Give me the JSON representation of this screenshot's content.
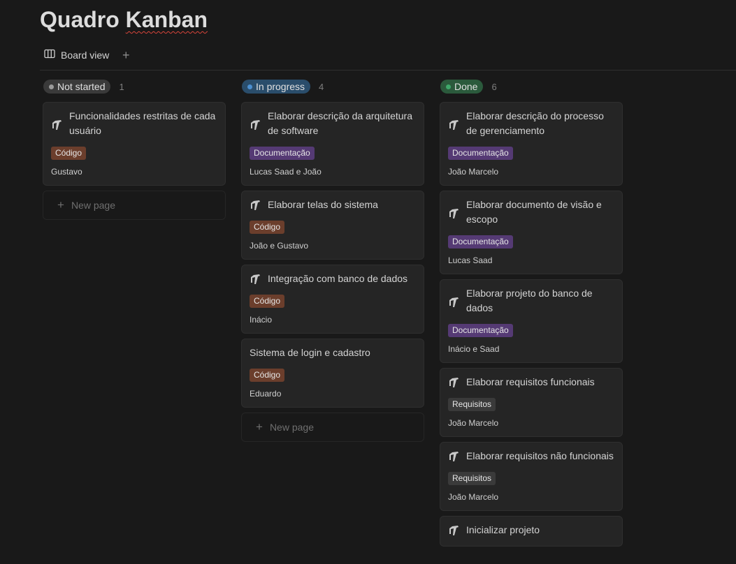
{
  "page": {
    "title_part1": "Quadro",
    "title_part2": "Kanban"
  },
  "views": {
    "active_label": "Board view",
    "board_icon": "board-columns-icon",
    "add_icon": "plus-icon"
  },
  "colors": {
    "tag_codigo": "#6b3e2c",
    "tag_documentacao": "#553a74",
    "tag_requisitos": "#3a3a3a",
    "status_not_started": "#3a3a3a",
    "status_in_progress": "#2a4d6b",
    "status_done": "#2b5a3c"
  },
  "columns": [
    {
      "status": "Not started",
      "count": "1",
      "new_page_label": "New page",
      "cards": [
        {
          "title": "Funcionalidades restritas de cada usuário",
          "tag": "Código",
          "person": "Gustavo",
          "icon": "page-icon"
        }
      ]
    },
    {
      "status": "In progress",
      "count": "4",
      "new_page_label": "New page",
      "cards": [
        {
          "title": "Elaborar descrição da arquitetura de software",
          "tag": "Documentação",
          "person": "Lucas Saad e João",
          "icon": "page-icon"
        },
        {
          "title": "Elaborar telas do sistema",
          "tag": "Código",
          "person": "João e Gustavo",
          "icon": "page-icon"
        },
        {
          "title": "Integração com banco de dados",
          "tag": "Código",
          "person": "Inácio",
          "icon": "page-icon"
        },
        {
          "title": "Sistema de login e cadastro",
          "tag": "Código",
          "person": "Eduardo"
        }
      ]
    },
    {
      "status": "Done",
      "count": "6",
      "cards": [
        {
          "title": "Elaborar descrição do processo de gerenciamento",
          "tag": "Documentação",
          "person": "João Marcelo",
          "icon": "page-icon"
        },
        {
          "title": "Elaborar documento de visão e escopo",
          "tag": "Documentação",
          "person": "Lucas Saad",
          "icon": "page-icon"
        },
        {
          "title": "Elaborar projeto do banco de dados",
          "tag": "Documentação",
          "person": "Inácio e Saad",
          "icon": "page-icon"
        },
        {
          "title": "Elaborar requisitos funcionais",
          "tag": "Requisitos",
          "person": "João Marcelo",
          "icon": "page-icon"
        },
        {
          "title": "Elaborar requisitos não funcionais",
          "tag": "Requisitos",
          "person": "João Marcelo",
          "icon": "page-icon"
        },
        {
          "title": "Inicializar projeto",
          "icon": "page-icon"
        }
      ]
    }
  ]
}
